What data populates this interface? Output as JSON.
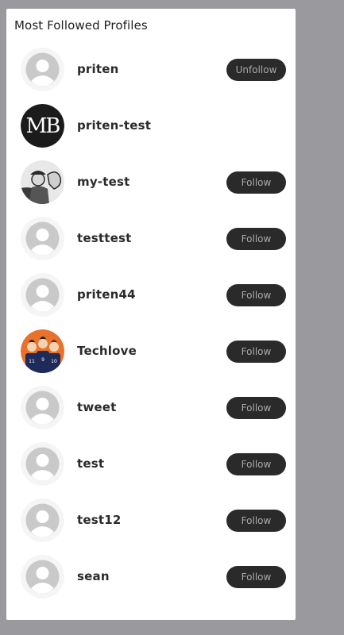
{
  "panel": {
    "title": "Most Followed Profiles"
  },
  "profiles": [
    {
      "username": "priten",
      "avatar": "default-avatar-icon",
      "button_label": "Unfollow"
    },
    {
      "username": "priten-test",
      "avatar": "mb-logo-avatar",
      "button_label": ""
    },
    {
      "username": "my-test",
      "avatar": "flexing-person-avatar",
      "button_label": "Follow"
    },
    {
      "username": "testtest",
      "avatar": "default-avatar-icon",
      "button_label": "Follow"
    },
    {
      "username": "priten44",
      "avatar": "default-avatar-icon",
      "button_label": "Follow"
    },
    {
      "username": "Techlove",
      "avatar": "team-photo-avatar",
      "button_label": "Follow"
    },
    {
      "username": "tweet",
      "avatar": "default-avatar-icon",
      "button_label": "Follow"
    },
    {
      "username": "test",
      "avatar": "default-avatar-icon",
      "button_label": "Follow"
    },
    {
      "username": "test12",
      "avatar": "default-avatar-icon",
      "button_label": "Follow"
    },
    {
      "username": "sean",
      "avatar": "default-avatar-icon",
      "button_label": "Follow"
    }
  ],
  "colors": {
    "background": "#9a999e",
    "card": "#ffffff",
    "button": "#2a2a2a",
    "button_text": "#a9a9a9",
    "default_avatar": "#c9c9c9"
  }
}
